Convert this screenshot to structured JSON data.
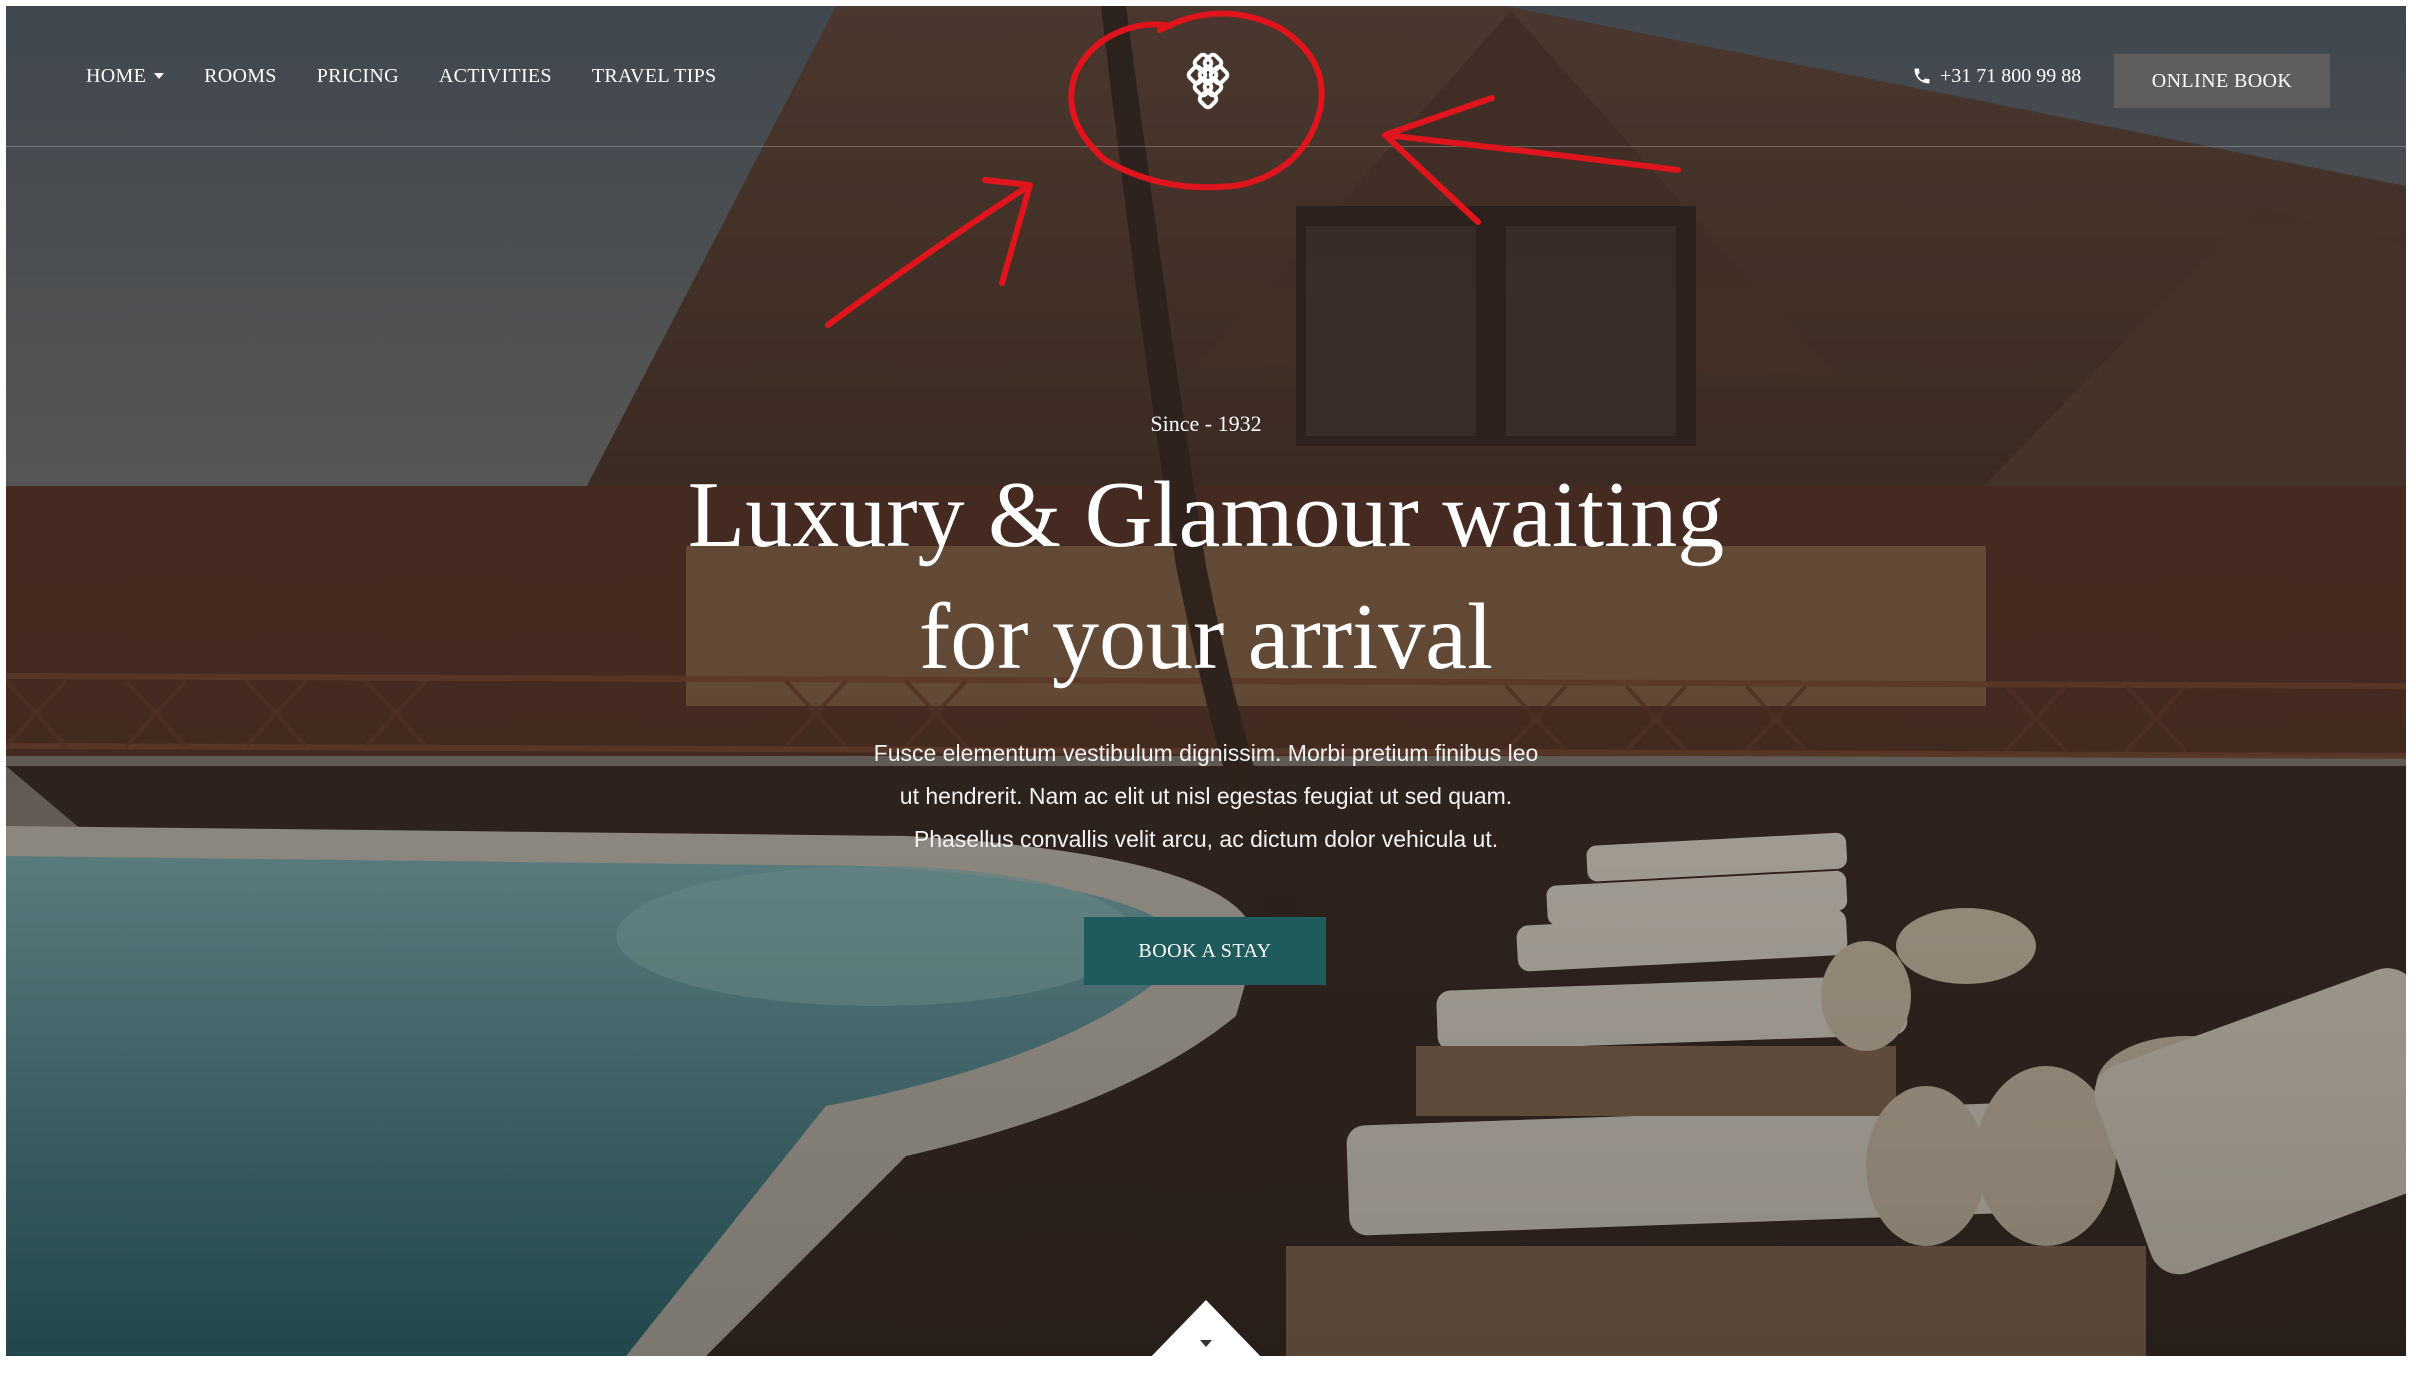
{
  "nav": {
    "items": [
      {
        "label": "HOME",
        "has_dropdown": true
      },
      {
        "label": "ROOMS"
      },
      {
        "label": "PRICING"
      },
      {
        "label": "ACTIVITIES"
      },
      {
        "label": "TRAVEL TIPS"
      }
    ],
    "logo_icon": "endless-knot-icon",
    "phone": "+31 71 800 99 88",
    "phone_icon": "phone-icon",
    "cta": "ONLINE BOOK"
  },
  "hero": {
    "eyebrow": "Since - 1932",
    "headline": [
      "Luxury & Glamour waiting",
      "for your arrival"
    ],
    "lede": [
      "Fusce elementum vestibulum dignissim. Morbi pretium finibus leo",
      "ut hendrerit. Nam ac elit ut nisl egestas feugiat ut sed quam.",
      "Phasellus convallis velit arcu, ac dictum dolor vehicula ut."
    ],
    "button": "BOOK A STAY",
    "scroll_icon": "caret-down-icon"
  },
  "colors": {
    "accent": "#1f5a5c",
    "annotation": "#e0141c",
    "text": "#ffffff"
  }
}
